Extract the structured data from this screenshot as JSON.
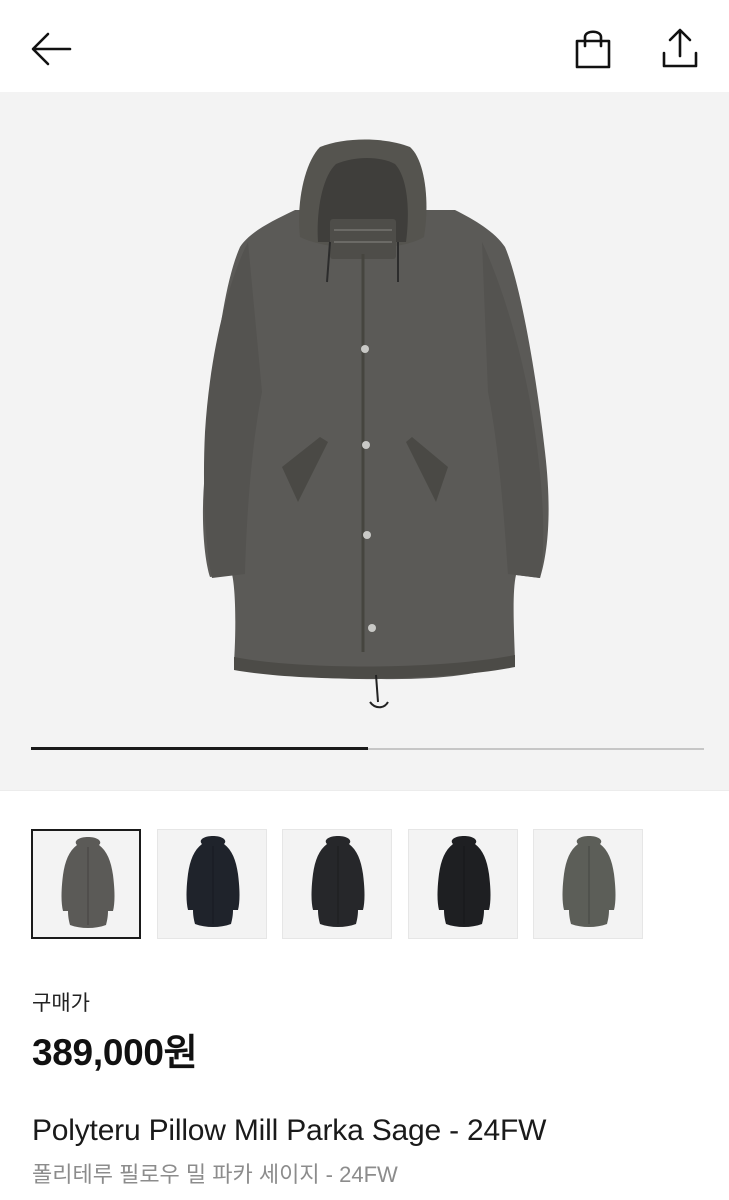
{
  "header": {
    "back_icon": "arrow-left-icon",
    "bag_icon": "shopping-bag-icon",
    "share_icon": "share-upload-icon"
  },
  "gallery": {
    "image_progress": 0.5,
    "thumbnail_colors": [
      "#5b5a57",
      "#1f232b",
      "#26272a",
      "#1e1f22",
      "#5c5e58"
    ],
    "selected_thumbnail": 0
  },
  "product": {
    "price_label": "구매가",
    "price": "389,000원",
    "title": "Polyteru Pillow Mill Parka Sage - 24FW",
    "subtitle": "폴리테루 필로우 밀 파카 세이지 - 24FW"
  },
  "colors": {
    "accent": "#1a1a1a",
    "image_background": "#f3f3f3",
    "coat_main": "#5b5a57"
  }
}
